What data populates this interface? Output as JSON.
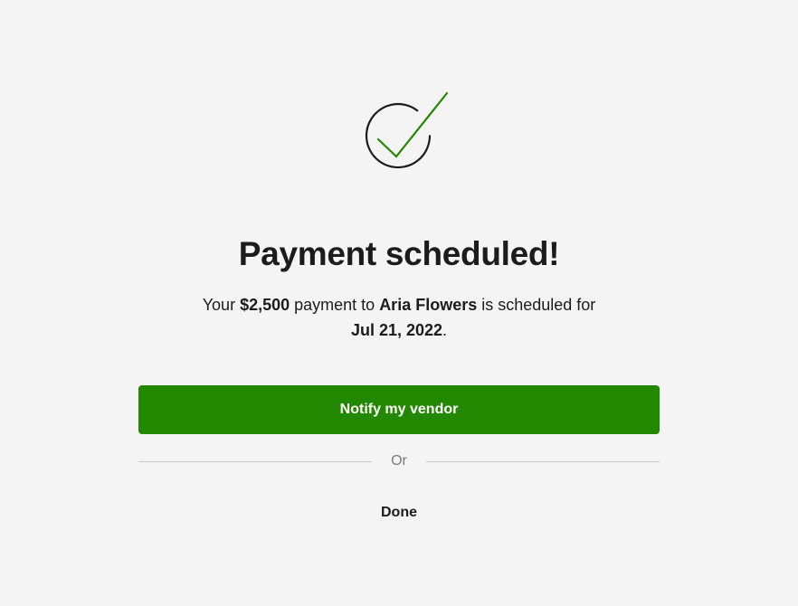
{
  "icon": "check-circle-icon",
  "colors": {
    "accent": "#228800",
    "check": "#228800",
    "background": "#f4f4f4",
    "text": "#1c1c1c"
  },
  "title": "Payment scheduled!",
  "message": {
    "prefix": "Your ",
    "amount": "$2,500",
    "middle": " payment to ",
    "vendor": "Aria Flowers",
    "suffix": " is scheduled for",
    "date": "Jul 21, 2022",
    "end": "."
  },
  "actions": {
    "notify_label": "Notify my vendor",
    "divider_label": "Or",
    "done_label": "Done"
  }
}
